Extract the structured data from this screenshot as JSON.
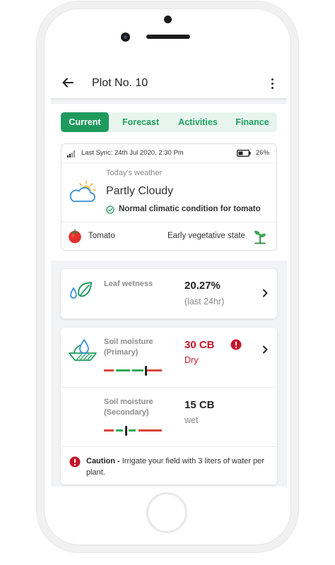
{
  "appbar": {
    "title": "Plot No. 10"
  },
  "tabs": [
    {
      "label": "Current",
      "active": true
    },
    {
      "label": "Forecast",
      "active": false
    },
    {
      "label": "Activities",
      "active": false
    },
    {
      "label": "Finance",
      "active": false
    }
  ],
  "status": {
    "sync": "Last Sync: 24th Jul 2020, 2:30 Pm",
    "battery": "26%",
    "battery_level": 0.26
  },
  "weather": {
    "heading": "Today's weather",
    "condition": "Partly Cloudy",
    "note": "Normal climatic condition for tomato"
  },
  "crop": {
    "name": "Tomato",
    "stage": "Early vegetative state"
  },
  "leaf_wetness": {
    "label": "Leaf wetness",
    "value": "20.27%",
    "period": "(last 24hr)"
  },
  "soil_primary": {
    "label_line1": "Soil moisture",
    "label_line2": "(Primary)",
    "value": "30 CB",
    "status": "Dry",
    "gauge_level": 0.73
  },
  "soil_secondary": {
    "label_line1": "Soil moisture",
    "label_line2": "(Secondary)",
    "value": "15 CB",
    "status": "wet",
    "gauge_level": 0.4
  },
  "caution": {
    "title": "Caution -",
    "message": "Irrigate your field with 3 liters of water per plant."
  },
  "colors": {
    "primary_green": "#1f9a5d",
    "tab_bg": "#e7f5ee",
    "alert_red": "#c4162a",
    "gauge_red": "#d9453a",
    "gauge_green": "#2fa955"
  }
}
